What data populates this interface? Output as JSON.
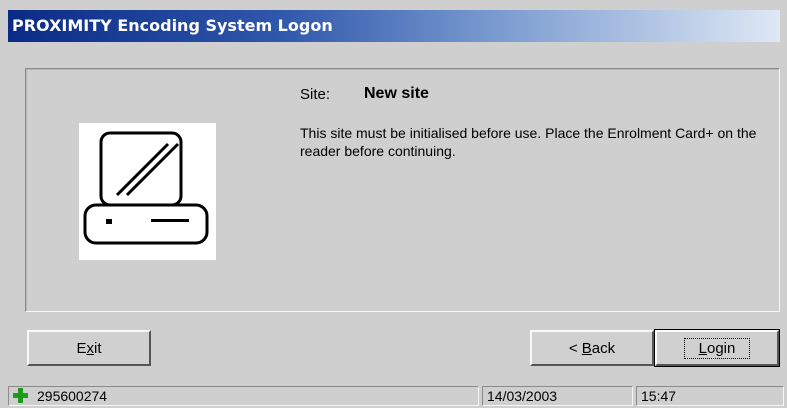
{
  "window": {
    "title": "PROXIMITY Encoding System Logon"
  },
  "site": {
    "label": "Site:",
    "value": "New site",
    "message": "This site must be initialised before use.  Place the Enrolment Card+ on the reader before continuing."
  },
  "buttons": {
    "exit": {
      "label_pre": "E",
      "label_accel": "x",
      "label_post": "it"
    },
    "back": {
      "label_pre": "< ",
      "label_accel": "B",
      "label_post": "ack"
    },
    "login": {
      "label_pre": "",
      "label_accel": "L",
      "label_post": "ogin"
    }
  },
  "status": {
    "id": "295600274",
    "date": "14/03/2003",
    "time": "15:47"
  },
  "icons": {
    "device": "card-reader-icon",
    "status": "green-plus-icon"
  },
  "colors": {
    "title_start": "#0a2a86",
    "title_end": "#dfe8f4",
    "face": "#cfcfcf",
    "status_plus": "#1f9a1f"
  }
}
